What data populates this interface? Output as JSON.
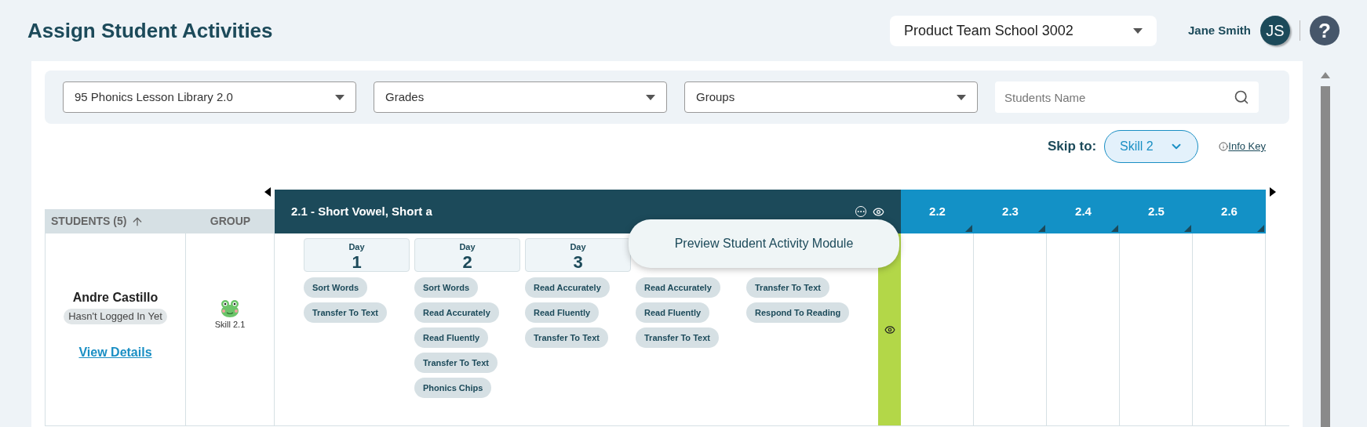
{
  "header": {
    "title": "Assign Student Activities",
    "school": "Product Team School 3002",
    "user_name": "Jane Smith",
    "avatar_initials": "JS",
    "help": "?"
  },
  "filters": [
    {
      "kind": "dropdown",
      "value": "95 Phonics Lesson Library 2.0"
    },
    {
      "kind": "dropdown",
      "value": "Grades"
    },
    {
      "kind": "dropdown",
      "value": "Groups"
    },
    {
      "kind": "search",
      "placeholder": "Students Name"
    }
  ],
  "skip_to": {
    "label": "Skip to:",
    "value": "Skill 2"
  },
  "info_key": "Info Key",
  "table": {
    "students_header": "STUDENTS (5)",
    "group_header": "GROUP",
    "current_skill": "2.1 - Short Vowel, Short a",
    "other_skills": [
      "2.2",
      "2.3",
      "2.4",
      "2.5",
      "2.6"
    ],
    "tooltip": "Preview Student Activity Module",
    "rows": [
      {
        "name": "Andre Castillo",
        "status": "Hasn't Logged In Yet",
        "link": "View Details",
        "group_label": "Skill 2.1",
        "completed": true,
        "days": [
          {
            "label": "Day",
            "number": "1",
            "activities": [
              "Sort Words",
              "Transfer To Text"
            ]
          },
          {
            "label": "Day",
            "number": "2",
            "activities": [
              "Sort Words",
              "Read Accurately",
              "Read Fluently",
              "Transfer To Text",
              "Phonics Chips"
            ]
          },
          {
            "label": "Day",
            "number": "3",
            "activities": [
              "Read Accurately",
              "Read Fluently",
              "Transfer To Text"
            ]
          },
          {
            "activities": [
              "Read Accurately",
              "Read Fluently",
              "Transfer To Text"
            ]
          },
          {
            "activities": [
              "Transfer To Text",
              "Respond To Reading"
            ]
          }
        ]
      }
    ]
  }
}
